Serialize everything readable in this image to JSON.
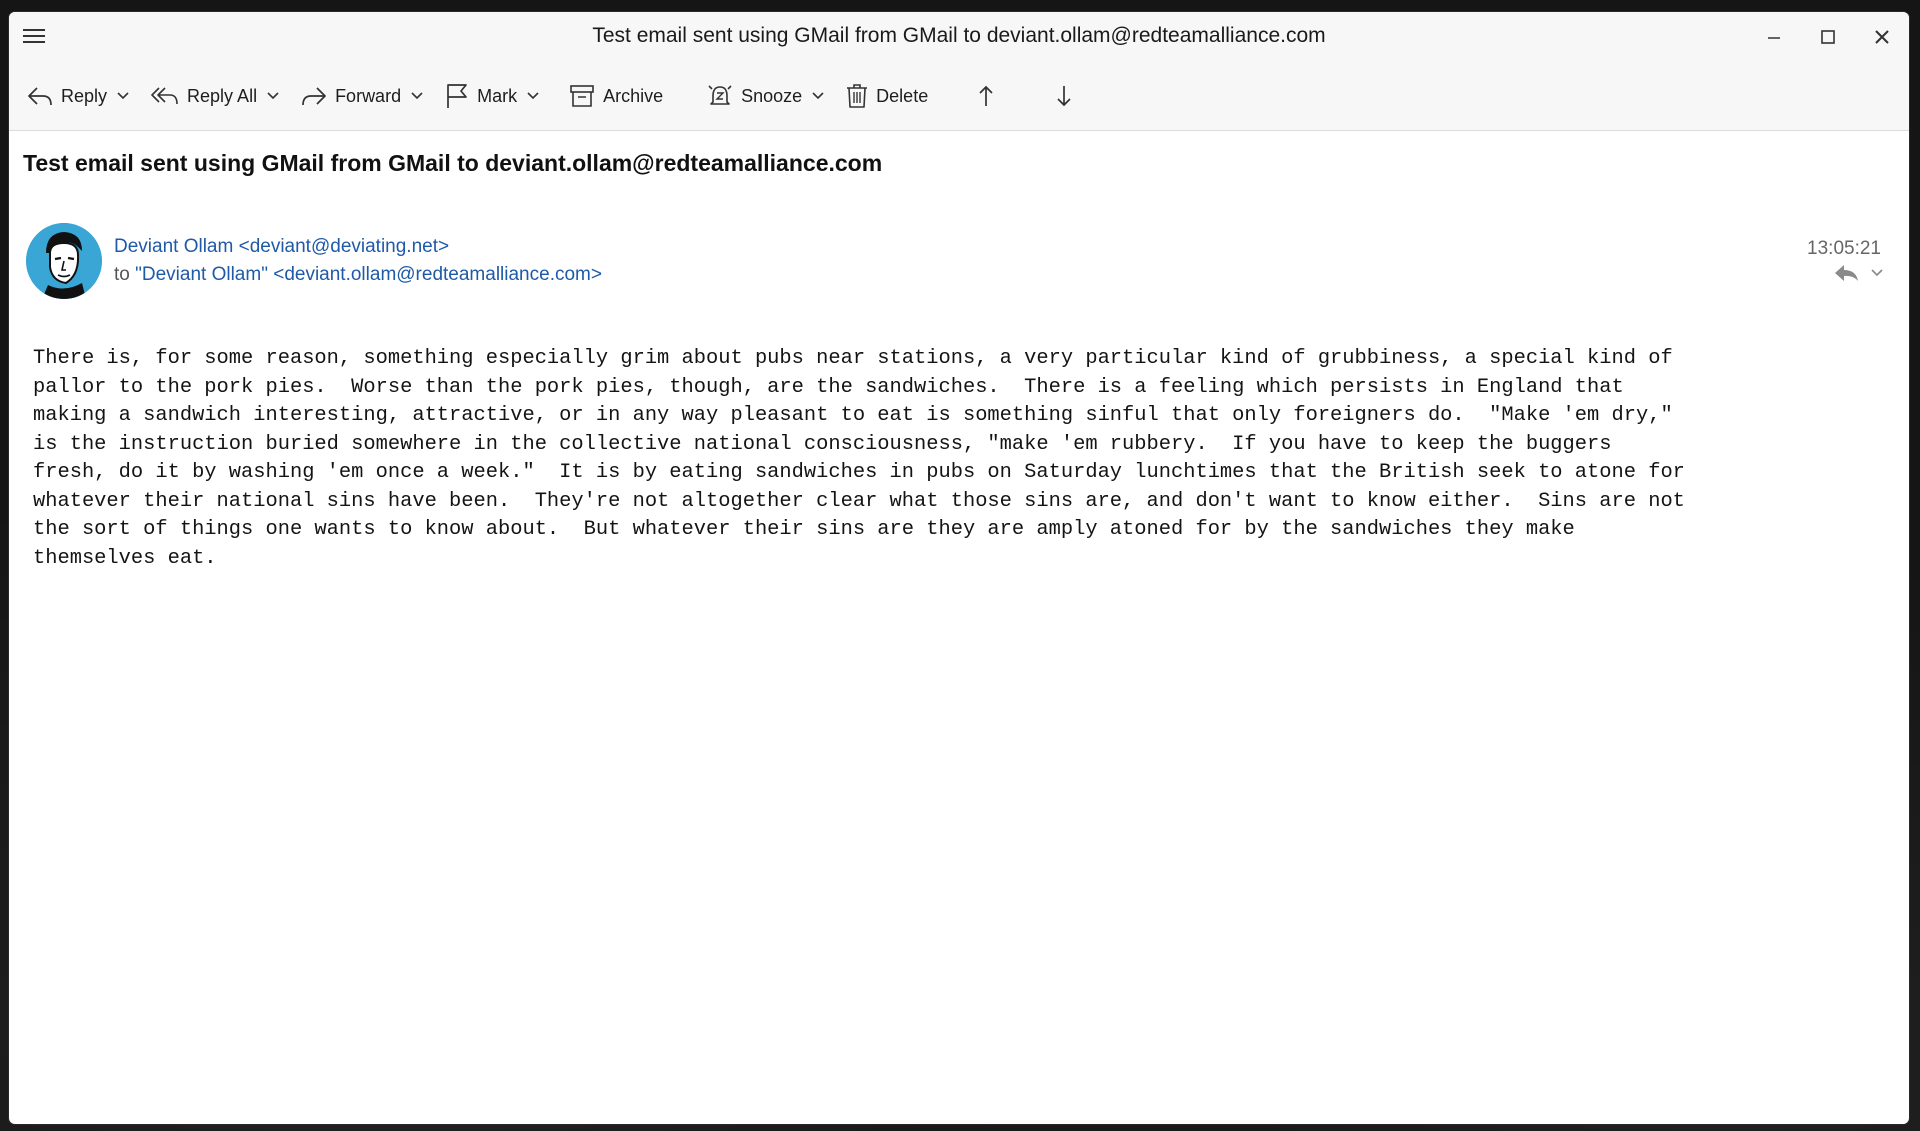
{
  "window": {
    "title": "Test email sent using GMail from GMail to deviant.ollam@redteamalliance.com"
  },
  "toolbar": {
    "reply": "Reply",
    "reply_all": "Reply All",
    "forward": "Forward",
    "mark": "Mark",
    "archive": "Archive",
    "snooze": "Snooze",
    "delete": "Delete"
  },
  "message": {
    "subject": "Test email sent using GMail from GMail to deviant.ollam@redteamalliance.com",
    "from": "Deviant Ollam <deviant@deviating.net>",
    "to_prefix": "to",
    "to": "\"Deviant Ollam\" <deviant.ollam@redteamalliance.com>",
    "time": "13:05:21",
    "body": "There is, for some reason, something especially grim about pubs near stations, a very particular kind of grubbiness, a special kind of\npallor to the pork pies.  Worse than the pork pies, though, are the sandwiches.  There is a feeling which persists in England that\nmaking a sandwich interesting, attractive, or in any way pleasant to eat is something sinful that only foreigners do.  \"Make 'em dry,\"\nis the instruction buried somewhere in the collective national consciousness, \"make 'em rubbery.  If you have to keep the buggers\nfresh, do it by washing 'em once a week.\"  It is by eating sandwiches in pubs on Saturday lunchtimes that the British seek to atone for\nwhatever their national sins have been.  They're not altogether clear what those sins are, and don't want to know either.  Sins are not\nthe sort of things one wants to know about.  But whatever their sins are they are amply atoned for by the sandwiches they make\nthemselves eat."
  },
  "icons": {
    "menu": "hamburger-icon",
    "minimize": "minimize-icon",
    "maximize": "maximize-icon",
    "close": "close-icon",
    "reply": "reply-icon",
    "reply_all": "reply-all-icon",
    "forward": "forward-icon",
    "mark": "flag-icon",
    "archive": "archive-icon",
    "snooze": "snooze-icon",
    "delete": "trash-icon",
    "previous": "arrow-up-icon",
    "next": "arrow-down-icon"
  },
  "colors": {
    "link": "#1f5aa8",
    "avatar_bg": "#3aa6d6",
    "toolbar_bg": "#f7f7f7"
  }
}
